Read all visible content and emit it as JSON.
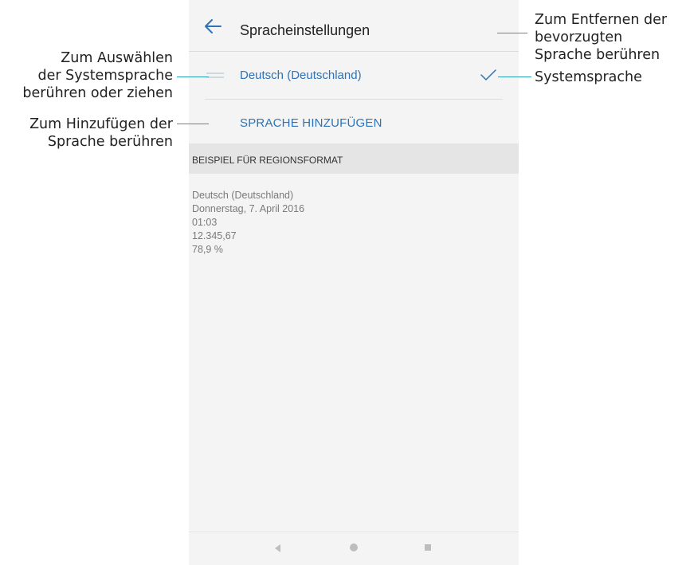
{
  "header": {
    "title": "Spracheinstellungen",
    "back_icon": "arrow-left-icon"
  },
  "language_list": {
    "items": [
      {
        "label": "Deutsch (Deutschland)",
        "selected": true
      }
    ],
    "add_label": "SPRACHE HINZUFÜGEN",
    "accent_color": "#2f73b6"
  },
  "region_format": {
    "header": "BEISPIEL FÜR REGIONSFORMAT",
    "lines": [
      "Deutsch (Deutschland)",
      "Donnerstag, 7. April 2016",
      "01:03",
      "12.345,67",
      "78,9 %"
    ]
  },
  "annotations": {
    "select_system_lang": [
      "Zum Auswählen",
      "der Systemsprache",
      "berühren oder ziehen"
    ],
    "add_lang": [
      "Zum Hinzufügen der",
      "Sprache berühren"
    ],
    "remove_lang": [
      "Zum Entfernen der",
      "bevorzugten",
      "Sprache berühren"
    ],
    "system_lang": "Systemsprache",
    "line_color": "#2a9fb5"
  },
  "nav_bar": {
    "icons": [
      "nav-back-icon",
      "nav-home-icon",
      "nav-recent-icon"
    ]
  }
}
